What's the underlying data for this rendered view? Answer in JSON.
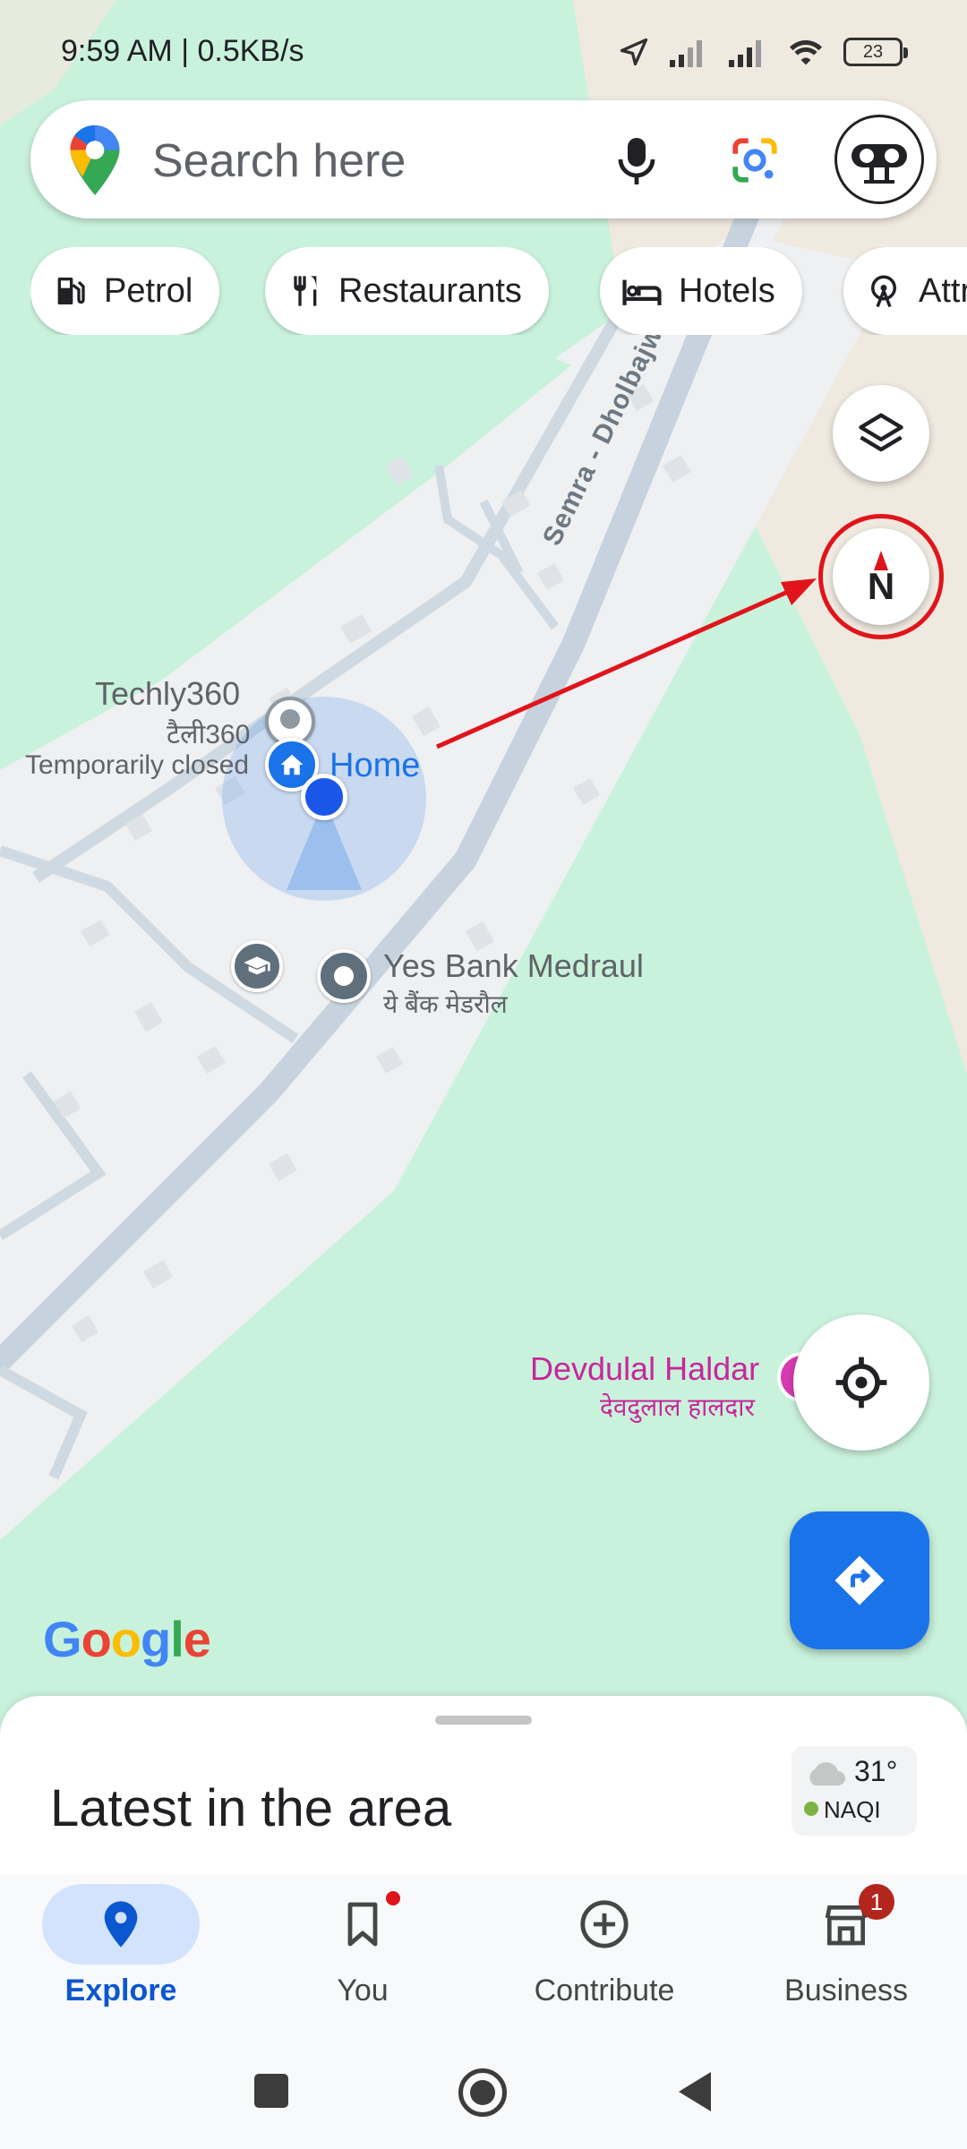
{
  "status_bar": {
    "time": "9:59 AM | 0.5KB/s",
    "battery": "23"
  },
  "search": {
    "placeholder": "Search here"
  },
  "chips": [
    {
      "label": "Petrol",
      "icon": "fuel-pump-icon"
    },
    {
      "label": "Restaurants",
      "icon": "fork-knife-icon"
    },
    {
      "label": "Hotels",
      "icon": "bed-icon"
    },
    {
      "label": "Attractions",
      "icon": "ferris-wheel-icon"
    }
  ],
  "map": {
    "road_name": "Semra - Dholbajwa Rd",
    "places": {
      "techly": {
        "name": "Techly360",
        "name_local": "टैली360",
        "status": "Temporarily closed"
      },
      "home": {
        "name": "Home"
      },
      "yes_bank": {
        "name": "Yes Bank Medraul",
        "name_local": "ये बैंक मेडरौल"
      },
      "devdulal": {
        "name": "Devdulal Haldar",
        "name_local": "देवदुलाल हालदार"
      }
    },
    "compass_label": "N",
    "logo_text": "Google"
  },
  "bottom_sheet": {
    "title": "Latest in the area",
    "weather": {
      "temp": "31°",
      "air_quality": "NAQI"
    }
  },
  "bottom_nav": {
    "items": [
      {
        "label": "Explore",
        "icon": "location-pin-icon",
        "active": true
      },
      {
        "label": "You",
        "icon": "bookmark-icon",
        "active": false
      },
      {
        "label": "Contribute",
        "icon": "add-circle-icon",
        "active": false
      },
      {
        "label": "Business",
        "icon": "storefront-icon",
        "active": false,
        "badge": "1"
      }
    ]
  },
  "colors": {
    "accent": "#1a73e8",
    "annotation": "#e0141b",
    "map_green": "#c8f3da",
    "map_road": "#c5d1dc",
    "place_pink": "#c8279a"
  }
}
